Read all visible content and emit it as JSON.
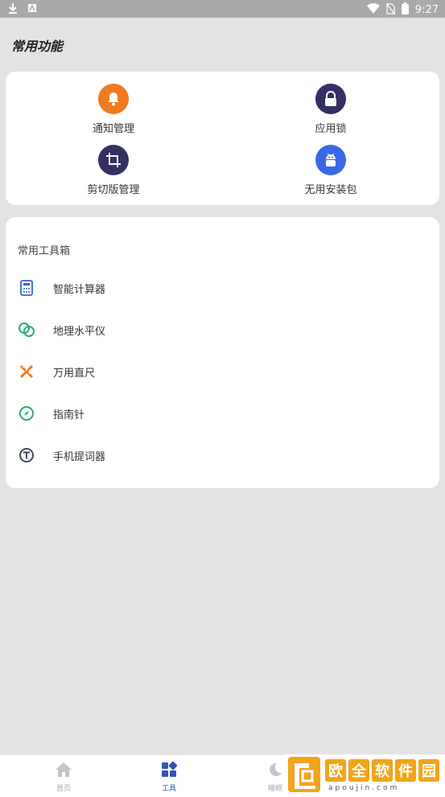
{
  "status_bar": {
    "time": "9:27"
  },
  "page": {
    "title": "常用功能"
  },
  "functions": [
    {
      "label": "通知管理",
      "icon": "bell-icon",
      "color": "#f07a1e"
    },
    {
      "label": "应用锁",
      "icon": "lock-icon",
      "color": "#343063"
    },
    {
      "label": "剪切版管理",
      "icon": "crop-icon",
      "color": "#343063"
    },
    {
      "label": "无用安装包",
      "icon": "android-icon",
      "color": "#3968e4"
    }
  ],
  "toolbox": {
    "title": "常用工具箱",
    "items": [
      {
        "label": "智能计算器",
        "icon": "calculator-icon",
        "color": "#3a64c8"
      },
      {
        "label": "地理水平仪",
        "icon": "level-icon",
        "color": "#2eb06a"
      },
      {
        "label": "万用直尺",
        "icon": "ruler-icon",
        "color": "#ef7a28"
      },
      {
        "label": "指南针",
        "icon": "compass-icon",
        "color": "#2eb06a"
      },
      {
        "label": "手机提词器",
        "icon": "teleprompter-icon",
        "color": "#444a5e"
      }
    ]
  },
  "nav": {
    "items": [
      {
        "label": "首页",
        "icon": "home-icon"
      },
      {
        "label": "工具",
        "icon": "tools-icon",
        "active": true
      },
      {
        "label": "睡眠",
        "icon": "sleep-icon"
      }
    ]
  },
  "watermark": {
    "chars": [
      "欧",
      "全",
      "软",
      "件",
      "园"
    ],
    "domain": "apoujin.com"
  }
}
